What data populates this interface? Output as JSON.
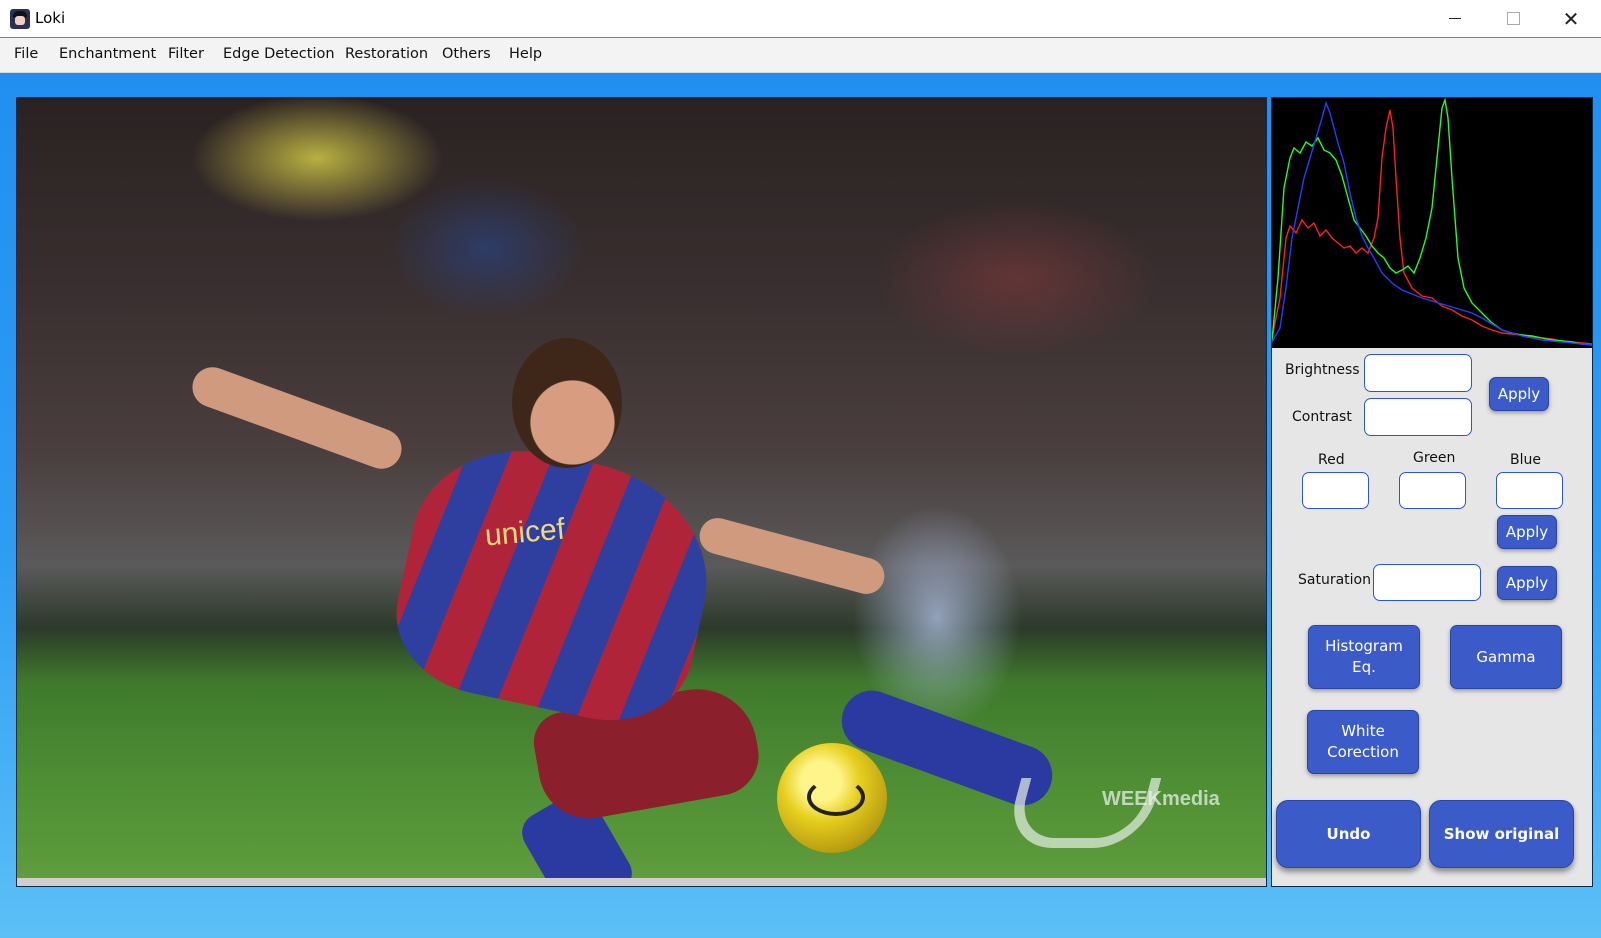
{
  "window": {
    "title": "Loki",
    "minimize": "—",
    "maximize": "☐",
    "close": "✕"
  },
  "menu": [
    "File",
    "Enchantment",
    "Filter",
    "Edge Detection",
    "Restoration",
    "Others",
    "Help"
  ],
  "image": {
    "jersey_text": "unicef",
    "watermark": "WEEKmedia"
  },
  "histogram": {
    "channels": [
      "red",
      "green",
      "blue"
    ],
    "colors": {
      "red": "#ff2020",
      "green": "#20ff20",
      "blue": "#2040ff"
    }
  },
  "controls": {
    "brightness_label": "Brightness",
    "brightness_value": "",
    "contrast_label": "Contrast",
    "contrast_value": "",
    "apply_bc": "Apply",
    "red_label": "Red",
    "red_value": "",
    "green_label": "Green",
    "green_value": "",
    "blue_label": "Blue",
    "blue_value": "",
    "apply_rgb": "Apply",
    "saturation_label": "Saturation",
    "saturation_value": "",
    "apply_saturation": "Apply",
    "histogram_eq": "Histogram Eq.",
    "gamma": "Gamma",
    "white_correction": "White Corection",
    "undo": "Undo",
    "show_original": "Show original"
  },
  "colors": {
    "accent": "#3b5bc9",
    "background_top": "#1e8df0",
    "background_bottom": "#5cc0f6"
  }
}
